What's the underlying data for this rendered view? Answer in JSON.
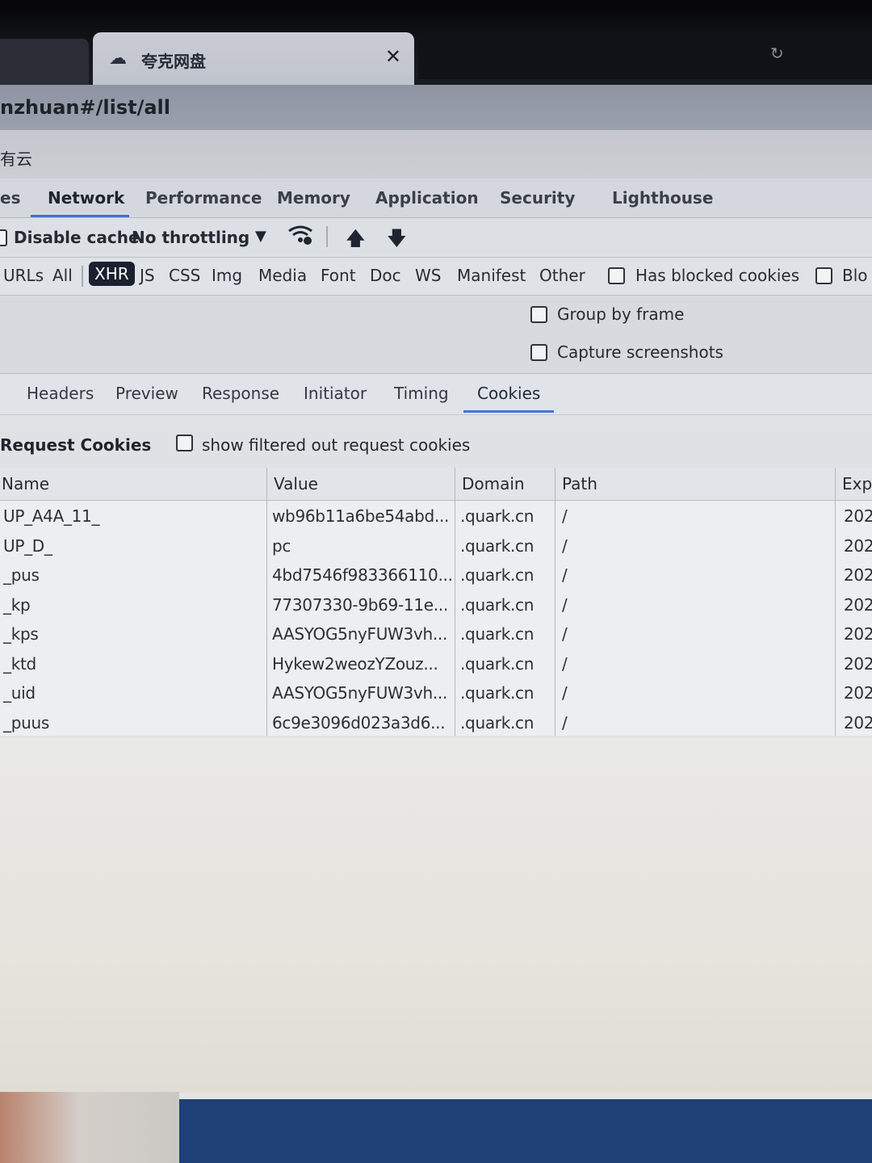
{
  "browser": {
    "active_tab_title": "夸克网盘",
    "active_tab_close": "✕",
    "inactive_tab_text": "",
    "url_fragment": "nzhuan#/list/all",
    "bookmark_fragment": "有云"
  },
  "devtools": {
    "panel_tabs": [
      "es",
      "Network",
      "Performance",
      "Memory",
      "Application",
      "Security",
      "Lighthouse"
    ],
    "active_panel": "Network",
    "toolbar": {
      "disable_cache_label": "Disable cache",
      "throttling_label": "No throttling"
    },
    "filters": [
      "URLs",
      "All",
      "XHR",
      "JS",
      "CSS",
      "Img",
      "Media",
      "Font",
      "Doc",
      "WS",
      "Manifest",
      "Other"
    ],
    "active_filter": "XHR",
    "has_blocked_cookies_label": "Has blocked cookies",
    "blocked_label_fragment": "Blo",
    "options": {
      "group_by_frame": "Group by frame",
      "capture_screenshots": "Capture screenshots"
    },
    "subtabs": [
      "Headers",
      "Preview",
      "Response",
      "Initiator",
      "Timing",
      "Cookies"
    ],
    "active_subtab": "Cookies",
    "request_cookies": {
      "title": "Request Cookies",
      "show_filtered_label": "show filtered out request cookies",
      "columns": [
        "Name",
        "Value",
        "Domain",
        "Path",
        "Exp"
      ],
      "rows": [
        {
          "name": "UP_A4A_11_",
          "value": "wb96b11a6be54abd...",
          "domain": ".quark.cn",
          "path": "/",
          "exp": "202"
        },
        {
          "name": "UP_D_",
          "value": "pc",
          "domain": ".quark.cn",
          "path": "/",
          "exp": "202"
        },
        {
          "name": "_pus",
          "value": "4bd7546f983366110...",
          "domain": ".quark.cn",
          "path": "/",
          "exp": "202"
        },
        {
          "name": "_kp",
          "value": "77307330-9b69-11e...",
          "domain": ".quark.cn",
          "path": "/",
          "exp": "202"
        },
        {
          "name": "_kps",
          "value": "AASYOG5nyFUW3vh...",
          "domain": ".quark.cn",
          "path": "/",
          "exp": "202"
        },
        {
          "name": "_ktd",
          "value": "Hykew2weozYZouz...",
          "domain": ".quark.cn",
          "path": "/",
          "exp": "202"
        },
        {
          "name": "_uid",
          "value": "AASYOG5nyFUW3vh...",
          "domain": ".quark.cn",
          "path": "/",
          "exp": "202"
        },
        {
          "name": "_puus",
          "value": "6c9e3096d023a3d6...",
          "domain": ".quark.cn",
          "path": "/",
          "exp": "202"
        }
      ]
    }
  },
  "colors": {
    "accent_underline": "#3c73c8",
    "active_filter_bg": "#1b2030",
    "taskbar": "#1f3f77"
  }
}
